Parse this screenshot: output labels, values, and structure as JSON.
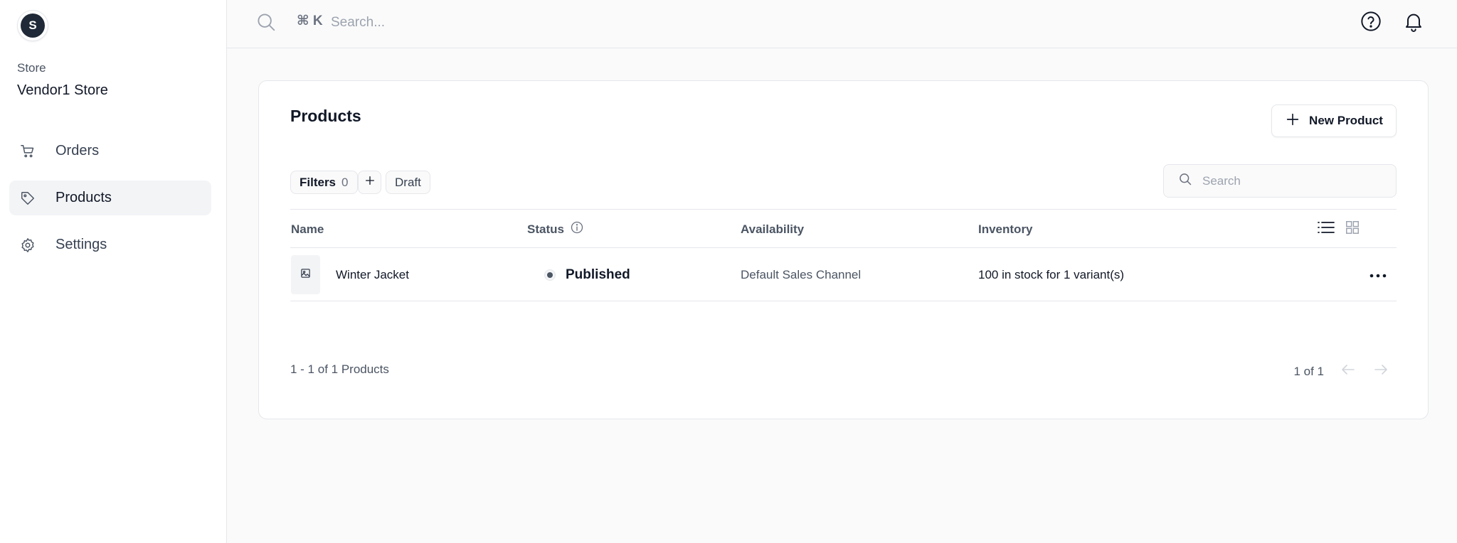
{
  "sidebar": {
    "avatar_letter": "S",
    "store_label": "Store",
    "store_name": "Vendor1 Store",
    "items": [
      {
        "label": "Orders",
        "icon": "cart-icon"
      },
      {
        "label": "Products",
        "icon": "tag-icon",
        "active": true
      },
      {
        "label": "Settings",
        "icon": "gear-icon"
      }
    ]
  },
  "topbar": {
    "shortcut": "⌘ K",
    "search_placeholder": "Search..."
  },
  "products": {
    "title": "Products",
    "new_button_label": "New Product",
    "filters_label": "Filters",
    "filters_count": "0",
    "draft_chip": "Draft",
    "search_placeholder": "Search",
    "columns": [
      "Name",
      "Status",
      "Availability",
      "Inventory"
    ],
    "rows": [
      {
        "name": "Winter Jacket",
        "status": "Published",
        "availability": "Default Sales Channel",
        "inventory": "100 in stock for 1 variant(s)"
      }
    ],
    "pagination": {
      "summary": "1 - 1 of 1 Products",
      "page": "1 of 1"
    }
  },
  "colors": {
    "background": "#fafafa",
    "border": "#e5e7eb",
    "text": "#111827",
    "muted": "#6b7280",
    "active_nav": "#f3f4f6"
  }
}
